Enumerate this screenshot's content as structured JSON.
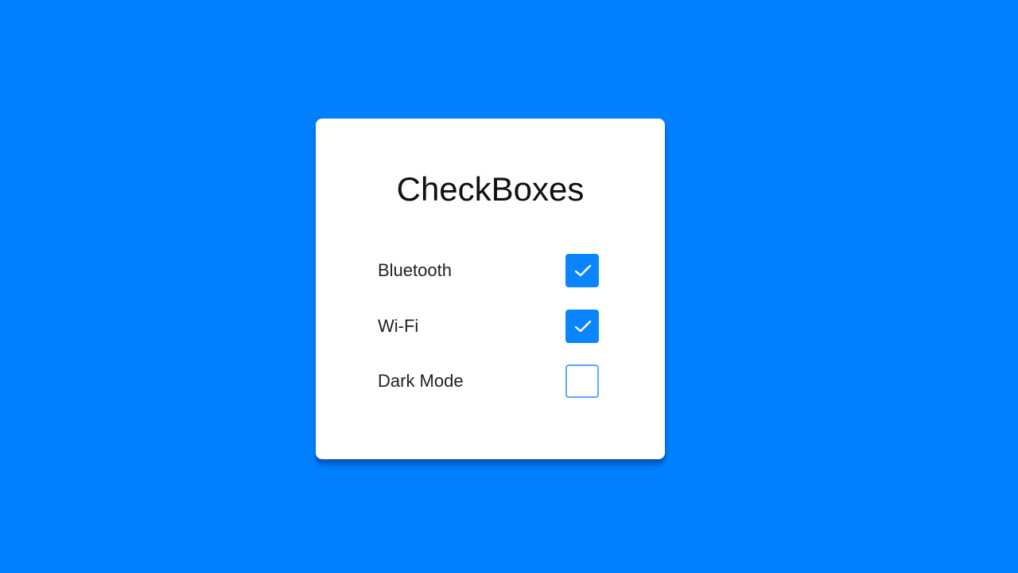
{
  "card": {
    "title": "CheckBoxes"
  },
  "options": [
    {
      "label": "Bluetooth",
      "checked": true
    },
    {
      "label": "Wi-Fi",
      "checked": true
    },
    {
      "label": "Dark Mode",
      "checked": false
    }
  ],
  "colors": {
    "background": "#0080ff",
    "card": "#ffffff",
    "accent": "#0a84ff",
    "unchecked_border": "#5aa9ff"
  },
  "icons": {
    "checked": "check-icon"
  }
}
